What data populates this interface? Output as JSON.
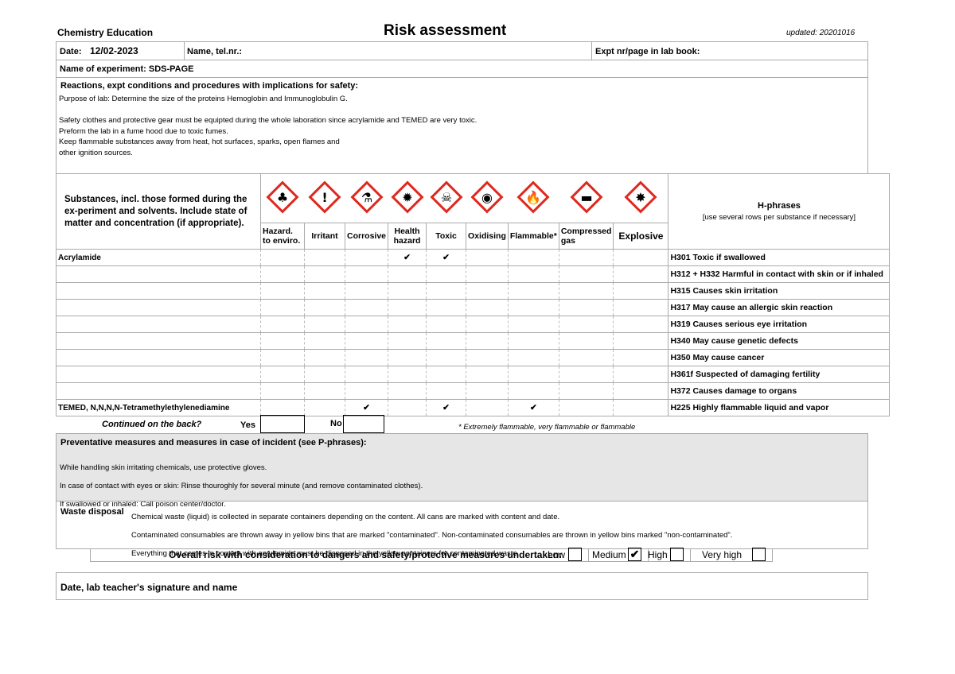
{
  "header": {
    "org": "Chemistry Education",
    "title": "Risk assessment",
    "updated": "updated: 20201016"
  },
  "info": {
    "date_label": "Date:",
    "date_value": "12/02-2023",
    "name_label": "Name, tel.nr.:",
    "expt_label": "Expt nr/page in lab book:",
    "experiment": "Name of experiment: SDS-PAGE"
  },
  "reactions": {
    "heading": "Reactions, expt conditions and procedures with implications for safety:",
    "lines": [
      "Purpose of lab: Determine the size of the proteins Hemoglobin and Immunoglobulin G.",
      "",
      "Safety clothes and protective gear must be equipted during the whole laboration since acrylamide and TEMED are very toxic.",
      "Preform the lab in a fume hood due to toxic fumes.",
      "Keep flammable substances away from heat, hot surfaces, sparks, open flames and",
      "other ignition sources."
    ]
  },
  "substances_heading": "Substances, incl. those formed during the ex-periment and solvents. Include state of matter and concentration (if appropriate).",
  "hphrases_heading": "H-phrases",
  "hphrases_note": "[use several rows per substance if necessary]",
  "hazards": [
    {
      "label": "Hazard. to enviro.",
      "icon": "environment-pictogram-icon",
      "glyph": "♣"
    },
    {
      "label": "Irritant",
      "icon": "exclamation-pictogram-icon",
      "glyph": "!"
    },
    {
      "label": "Corrosive",
      "icon": "corrosive-pictogram-icon",
      "glyph": "⚗"
    },
    {
      "label": "Health hazard",
      "icon": "health-hazard-pictogram-icon",
      "glyph": "✹"
    },
    {
      "label": "Toxic",
      "icon": "skull-pictogram-icon",
      "glyph": "☠"
    },
    {
      "label": "Oxidising",
      "icon": "oxidising-pictogram-icon",
      "glyph": "◉"
    },
    {
      "label": "Flammable*",
      "icon": "flame-pictogram-icon",
      "glyph": "🔥"
    },
    {
      "label": "Compressed gas",
      "icon": "gas-cylinder-pictogram-icon",
      "glyph": "▬"
    },
    {
      "label": "Explosive",
      "icon": "explosive-pictogram-icon",
      "glyph": "✸"
    }
  ],
  "check_mark": "✔",
  "rows": [
    {
      "substance": "Acrylamide",
      "checks": [
        false,
        false,
        false,
        true,
        true,
        false,
        false,
        false,
        false
      ],
      "hphrase": "H301 Toxic if swallowed"
    },
    {
      "substance": "",
      "checks": [
        false,
        false,
        false,
        false,
        false,
        false,
        false,
        false,
        false
      ],
      "hphrase": "H312 + H332 Harmful in contact with skin or if inhaled"
    },
    {
      "substance": "",
      "checks": [
        false,
        false,
        false,
        false,
        false,
        false,
        false,
        false,
        false
      ],
      "hphrase": "H315 Causes skin irritation"
    },
    {
      "substance": "",
      "checks": [
        false,
        false,
        false,
        false,
        false,
        false,
        false,
        false,
        false
      ],
      "hphrase": "H317 May cause an allergic skin reaction"
    },
    {
      "substance": "",
      "checks": [
        false,
        false,
        false,
        false,
        false,
        false,
        false,
        false,
        false
      ],
      "hphrase": "H319 Causes serious eye irritation"
    },
    {
      "substance": "",
      "checks": [
        false,
        false,
        false,
        false,
        false,
        false,
        false,
        false,
        false
      ],
      "hphrase": "H340 May cause genetic defects"
    },
    {
      "substance": "",
      "checks": [
        false,
        false,
        false,
        false,
        false,
        false,
        false,
        false,
        false
      ],
      "hphrase": "H350 May cause cancer"
    },
    {
      "substance": "",
      "checks": [
        false,
        false,
        false,
        false,
        false,
        false,
        false,
        false,
        false
      ],
      "hphrase": "H361f Suspected of damaging fertility"
    },
    {
      "substance": "",
      "checks": [
        false,
        false,
        false,
        false,
        false,
        false,
        false,
        false,
        false
      ],
      "hphrase": "H372 Causes damage to organs"
    },
    {
      "substance": "TEMED, N,N,N,N-Tetramethylethylenediamine",
      "checks": [
        false,
        false,
        true,
        false,
        true,
        false,
        true,
        false,
        false
      ],
      "hphrase": "H225 Highly flammable liquid and vapor"
    }
  ],
  "continued": {
    "label": "Continued on the back?",
    "yes": "Yes",
    "no": "No",
    "footnote": "* Extremely flammable, very flammable or flammable"
  },
  "preventative": {
    "heading": "Preventative measures and measures in case of incident (see P-phrases):",
    "lines": [
      "While handling skin irritating chemicals, use protective gloves.",
      "In case of contact with eyes or skin: Rinse thouroghly for several minute (and remove contaminated clothes).",
      "If swallowed or inhaled: Call poison center/doctor."
    ]
  },
  "waste": {
    "label": "Waste disposal",
    "lines": [
      "Chemical waste (liquid) is collected in separate containers depending on the content. All cans are marked with content and date.",
      "Contaminated consumables are thrown away in yellow bins that are marked \"contaminated\". Non-contaminated consumables are thrown in yellow bins marked \"non-contaminated\".",
      "Everything that comes in contact with acrylamide must be disposed in the yellow containers for contaminated waste."
    ]
  },
  "overall": {
    "label": "Overall risk with consideration to dangers and safety/protective measures undertaken:",
    "options": [
      {
        "label": "Low",
        "checked": false
      },
      {
        "label": "Medium",
        "checked": true
      },
      {
        "label": "High",
        "checked": false
      },
      {
        "label": "Very high",
        "checked": false
      }
    ]
  },
  "signature": "Date, lab teacher's signature and name",
  "colors": {
    "pictogram_border": "#e0281e",
    "shaded_bg": "#e6e6e6"
  }
}
